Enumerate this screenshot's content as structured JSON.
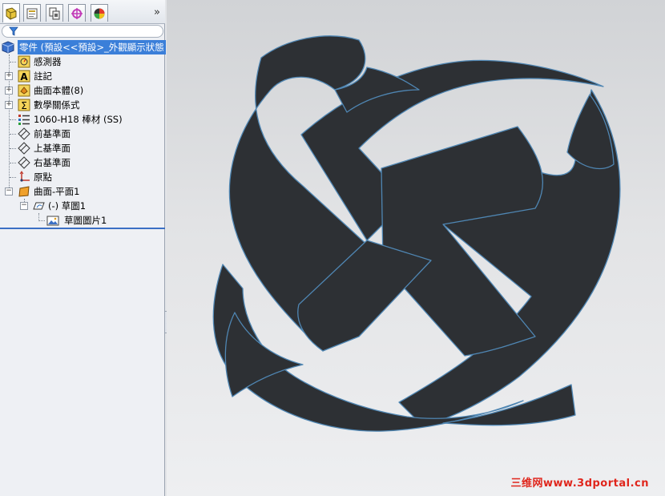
{
  "panel": {
    "tabs": [
      {
        "icon": "feature-manager-icon"
      },
      {
        "icon": "property-manager-icon"
      },
      {
        "icon": "configuration-manager-icon"
      },
      {
        "icon": "dimxpert-icon"
      },
      {
        "icon": "display-manager-icon"
      }
    ],
    "more": "»",
    "filter_icon": "filter-funnel-icon"
  },
  "tree": {
    "root": "零件 (預設<<預設>_外觀顯示狀態",
    "sensors": "感測器",
    "annotations": "註記",
    "surface_bodies": "曲面本體(8)",
    "equations": "數學關係式",
    "material": "1060-H18 棒材 (SS)",
    "front_plane": "前基準面",
    "top_plane": "上基準面",
    "right_plane": "右基準面",
    "origin": "原點",
    "surface_plane": "曲面-平面1",
    "sketch": "(-) 草圖1",
    "sketch_picture": "草圖圖片1"
  },
  "watermark": "三维网www.3dportal.cn",
  "colors": {
    "logo_fill": "#2d3034",
    "logo_edge": "#4f86b3",
    "selection": "#3b7fd9"
  }
}
